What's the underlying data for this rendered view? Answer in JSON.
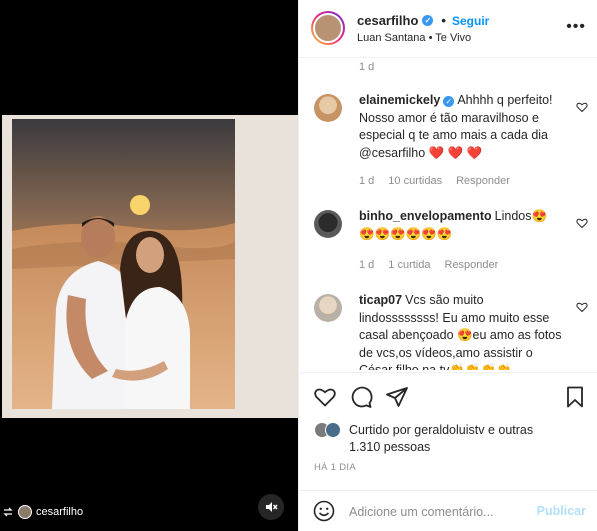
{
  "post": {
    "owner": "cesarfilho",
    "follow_label": "Seguir",
    "dot": "•",
    "audio": "Luan Santana • Te Vivo",
    "more": "•••"
  },
  "media": {
    "repost_user": "cesarfilho"
  },
  "comments": {
    "top_time": "1 d",
    "items": [
      {
        "user": "elainemickely",
        "verified": true,
        "text": "Ahhhh q perfeito! Nosso amor é tão maravilhoso e especial q te amo mais a cada dia @cesarfilho ❤️ ❤️ ❤️",
        "time": "1 d",
        "likes": "10 curtidas",
        "reply": "Responder"
      },
      {
        "user": "binho_envelopamento",
        "verified": false,
        "text": "Lindos😍 😍😍😍😍😍😍",
        "time": "1 d",
        "likes": "1 curtida",
        "reply": "Responder"
      },
      {
        "user": "ticap07",
        "verified": false,
        "text": "Vcs são muito lindossssssss! Eu amo muito esse casal abençoado 😍eu amo as fotos de vcs,os vídeos,amo assistir o César filho na tv👏👏👏👏",
        "time": "",
        "likes": "",
        "reply": ""
      }
    ]
  },
  "likes": {
    "text": "Curtido por geraldoluistv e outras 1.310 pessoas"
  },
  "posted_ago": "HÁ 1 DIA",
  "add_comment": {
    "placeholder": "Adicione um comentário...",
    "publish_label": "Publicar"
  },
  "colors": {
    "accent": "#0095f6",
    "muted": "#8e8e8e",
    "heart_red": "#ed4956"
  }
}
